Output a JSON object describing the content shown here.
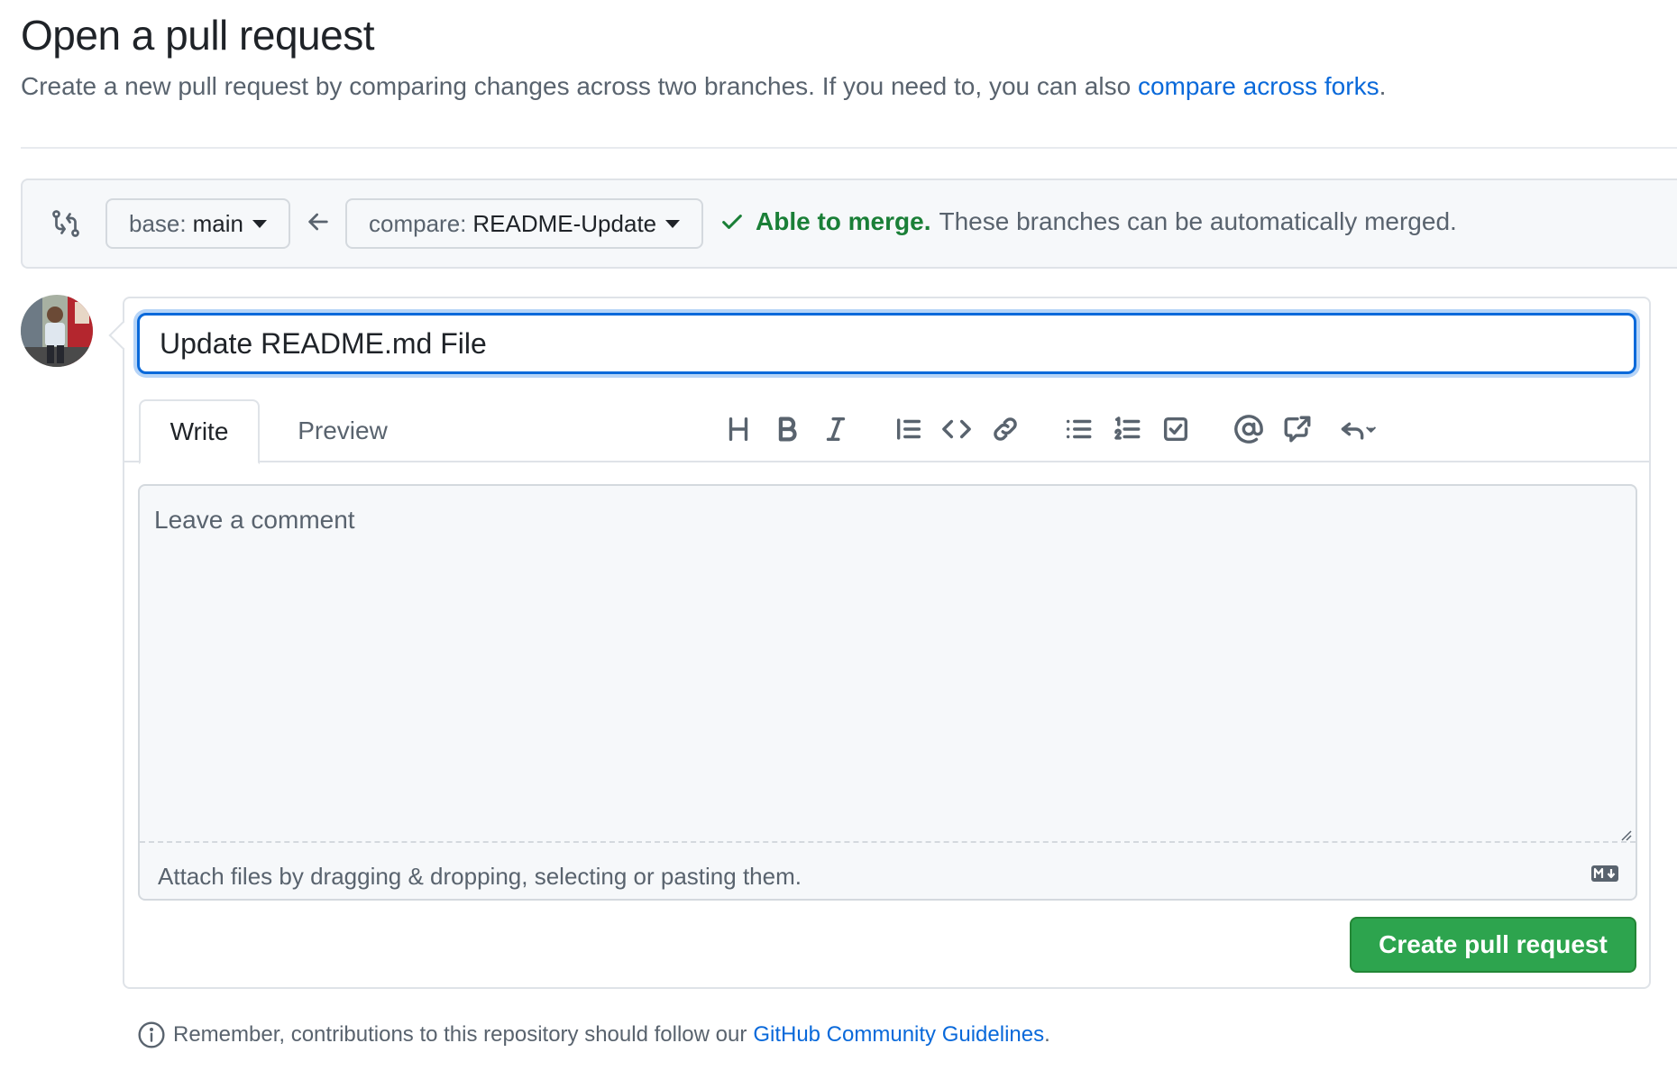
{
  "header": {
    "title": "Open a pull request",
    "subtitle": "Create a new pull request by comparing changes across two branches. If you need to, you can also",
    "subtitle_link": "compare across forks",
    "subtitle_end": "."
  },
  "range": {
    "base_prefix": "base:",
    "base_branch": "main",
    "compare_prefix": "compare:",
    "compare_branch": "README-Update",
    "merge_status": "Able to merge.",
    "merge_detail": "These branches can be automatically merged."
  },
  "form": {
    "title_value": "Update README.md File",
    "tabs": [
      "Write",
      "Preview"
    ],
    "toolbar": [
      "heading-icon",
      "bold-icon",
      "italic-icon",
      "quote-icon",
      "code-icon",
      "link-icon",
      "unordered-list-icon",
      "ordered-list-icon",
      "task-list-icon",
      "mention-icon",
      "cross-reference-icon",
      "reply-icon"
    ],
    "comment_placeholder": "Leave a comment",
    "attach_hint": "Attach files by dragging & dropping, selecting or pasting them.",
    "submit_label": "Create pull request"
  },
  "footer": {
    "guidelines_text": "Remember, contributions to this repository should follow our",
    "guidelines_link": "GitHub Community Guidelines",
    "guidelines_end": "."
  },
  "colors": {
    "accent": "#0969da",
    "success": "#1a7f37",
    "primary_button": "#2da44e"
  }
}
